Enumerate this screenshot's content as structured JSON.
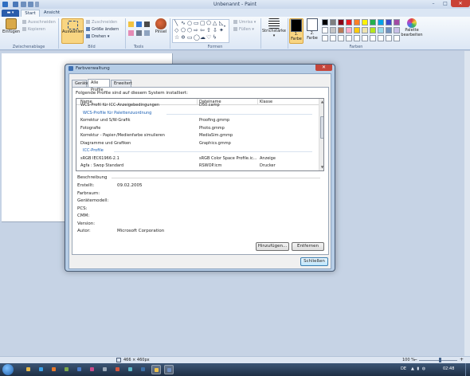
{
  "window": {
    "title": "Unbenannt - Paint",
    "minimize_glyph": "–",
    "maximize_glyph": "□",
    "close_glyph": "✕"
  },
  "ribbon_tabs": {
    "file_menu_glyph": "▬ ▾",
    "start": "Start",
    "view": "Ansicht"
  },
  "ribbon": {
    "clipboard": {
      "label": "Zwischenablage",
      "paste": "Einfügen",
      "cut": "Ausschneiden",
      "copy": "Kopieren"
    },
    "image": {
      "label": "Bild",
      "select": "Auswählen",
      "crop": "Zuschneiden",
      "resize": "Größe ändern",
      "rotate": "Drehen"
    },
    "tools": {
      "label": "Tools",
      "brush": "Pinsel"
    },
    "shapes": {
      "label": "Formen",
      "outline": "Umriss",
      "fill": "Füllen"
    },
    "stroke": {
      "label": "Strichstärke"
    },
    "colors": {
      "label": "Farben",
      "color1_line1": "1.",
      "color1_line2": "Farbe",
      "color2_line1": "2.",
      "color2_line2": "Farbe",
      "edit_palette_line1": "Palette",
      "edit_palette_line2": "bearbeiten",
      "color1_value": "#000000",
      "color2_value": "#ffffff",
      "palette_row1": [
        "#000000",
        "#7f7f7f",
        "#880015",
        "#ed1c24",
        "#ff7f27",
        "#fff200",
        "#22b14c",
        "#00a2e8",
        "#3f48cc",
        "#a349a4"
      ],
      "palette_row2": [
        "#ffffff",
        "#c3c3c3",
        "#b97a57",
        "#ffaec9",
        "#ffc90e",
        "#efe4b0",
        "#b5e61d",
        "#99d9ea",
        "#7092be",
        "#c8bfe7"
      ],
      "palette_row3": [
        "#ffffff",
        "#ffffff",
        "#ffffff",
        "#ffffff",
        "#ffffff",
        "#ffffff",
        "#ffffff",
        "#ffffff",
        "#ffffff",
        "#ffffff"
      ]
    }
  },
  "dialog": {
    "title": "Farbverwaltung",
    "close_glyph": "✕",
    "tabs": [
      "Geräte",
      "Alle Profile",
      "Erweitert"
    ],
    "installed_label": "Folgende Profile sind auf diesem System installiert:",
    "columns": {
      "name": "Name",
      "file": "Dateiname",
      "class": "Klasse"
    },
    "rows": [
      {
        "name": "WCS-Profil für ICC-Anzeigebedingungen",
        "file": "D50.camp",
        "class": ""
      },
      {
        "name": "WCS-Profile für Palettenzuordnung",
        "file": "",
        "class": "",
        "group": true
      },
      {
        "name": "Korrektur und S/W-Grafik",
        "file": "Proofing.gmmp",
        "class": ""
      },
      {
        "name": "Fotografie",
        "file": "Photo.gmmp",
        "class": ""
      },
      {
        "name": "Korrektur - Papier-/Medienfarbe simulieren",
        "file": "MediaSim.gmmp",
        "class": ""
      },
      {
        "name": "Diagramme und Grafiken",
        "file": "Graphics.gmmp",
        "class": ""
      },
      {
        "name": "ICC-Profile",
        "file": "",
        "class": "",
        "group": true
      },
      {
        "name": "sRGB IEC61966-2.1",
        "file": "sRGB Color Space Profile.ic...",
        "class": "Anzeige"
      },
      {
        "name": "Agfa : Swop Standard",
        "file": "RSWOP.icm",
        "class": "Drucker"
      }
    ],
    "description": {
      "heading": "Beschreibung",
      "fields": [
        {
          "label": "Erstellt:",
          "value": "09.02.2005"
        },
        {
          "label": "Farbraum:",
          "value": ""
        },
        {
          "label": "Gerätemodell:",
          "value": ""
        },
        {
          "label": "PCS:",
          "value": ""
        },
        {
          "label": "CMM:",
          "value": ""
        },
        {
          "label": "Version:",
          "value": ""
        },
        {
          "label": "Autor:",
          "value": "Microsoft Corporation"
        }
      ]
    },
    "buttons": {
      "add": "Hinzufügen...",
      "remove": "Entfernen",
      "close": "Schließen"
    }
  },
  "statusbar": {
    "canvas_size": "466 × 460px",
    "zoom": "100 %",
    "zoom_out": "−",
    "zoom_in": "+"
  },
  "taskbar": {
    "items": [
      {
        "name": "explorer",
        "color": "#e5b84a"
      },
      {
        "name": "internet-explorer",
        "color": "#3aa0e8"
      },
      {
        "name": "media-player",
        "color": "#e8792b"
      },
      {
        "name": "app-3",
        "color": "#7da94a"
      },
      {
        "name": "app-4",
        "color": "#4a7cc9"
      },
      {
        "name": "app-5",
        "color": "#c94a8a"
      },
      {
        "name": "app-6",
        "color": "#9aa8b8"
      },
      {
        "name": "app-7",
        "color": "#d2553e"
      },
      {
        "name": "app-8",
        "color": "#5ab7c8"
      },
      {
        "name": "app-9",
        "color": "#3b6ea5"
      },
      {
        "name": "paint",
        "color": "#f0c24a",
        "active": true
      },
      {
        "name": "color-management",
        "color": "#6f8fc2",
        "active": true
      }
    ],
    "language": "DE",
    "tray_icons": "▲ ▮ ◍",
    "clock": "02:48"
  }
}
